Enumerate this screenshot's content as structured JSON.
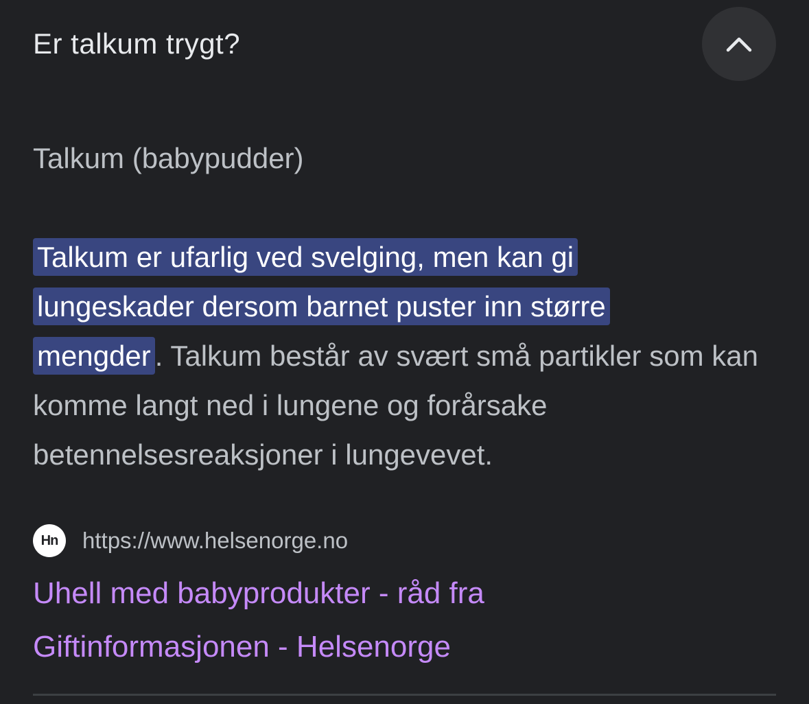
{
  "faq": {
    "question": "Er talkum trygt?",
    "collapse_icon": "chevron-up-icon",
    "subtitle": "Talkum (babypudder)",
    "answer": {
      "highlight_lines": [
        "Talkum er ufarlig ved svelging, men kan gi",
        "lungeskader dersom barnet puster inn større",
        "mengder"
      ],
      "rest": ". Talkum består av svært små partikler som kan komme langt ned i lungene og forårsake betennelsesreaksjoner i lungevevet."
    },
    "source": {
      "favicon_text": "Hn",
      "url": "https://www.helsenorge.no"
    },
    "link": {
      "line1": "Uhell med babyprodukter - råd fra",
      "line2": "Giftinformasjonen - Helsenorge"
    }
  },
  "colors": {
    "background": "#202124",
    "highlight": "#394680",
    "link": "#c58af9",
    "button": "#303134"
  }
}
